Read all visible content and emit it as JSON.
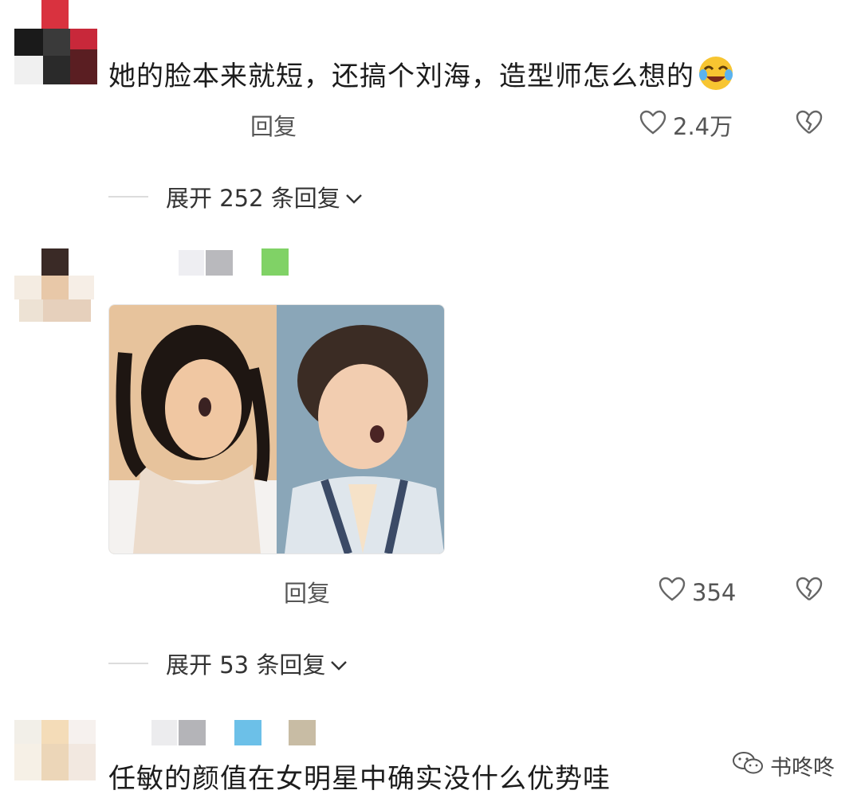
{
  "comments": [
    {
      "text": "她的脸本来就短，还搞个刘海，造型师怎么想的",
      "emoji_icon": "laugh-cry-emoji",
      "reply_label": "回复",
      "likes": "2.4万",
      "expand_label": "展开 252 条回复"
    },
    {
      "image_desc_icon": "photo-attachment",
      "reply_label": "回复",
      "likes": "354",
      "expand_label": "展开 53 条回复"
    },
    {
      "text": "任敏的颜值在女明星中确实没什么优势哇"
    }
  ],
  "watermark": {
    "label": "书咚咚",
    "icon": "wechat-icon"
  },
  "colors": {
    "text": "#1c1c1c",
    "muted": "#555555",
    "divider": "#dcdcdc"
  }
}
